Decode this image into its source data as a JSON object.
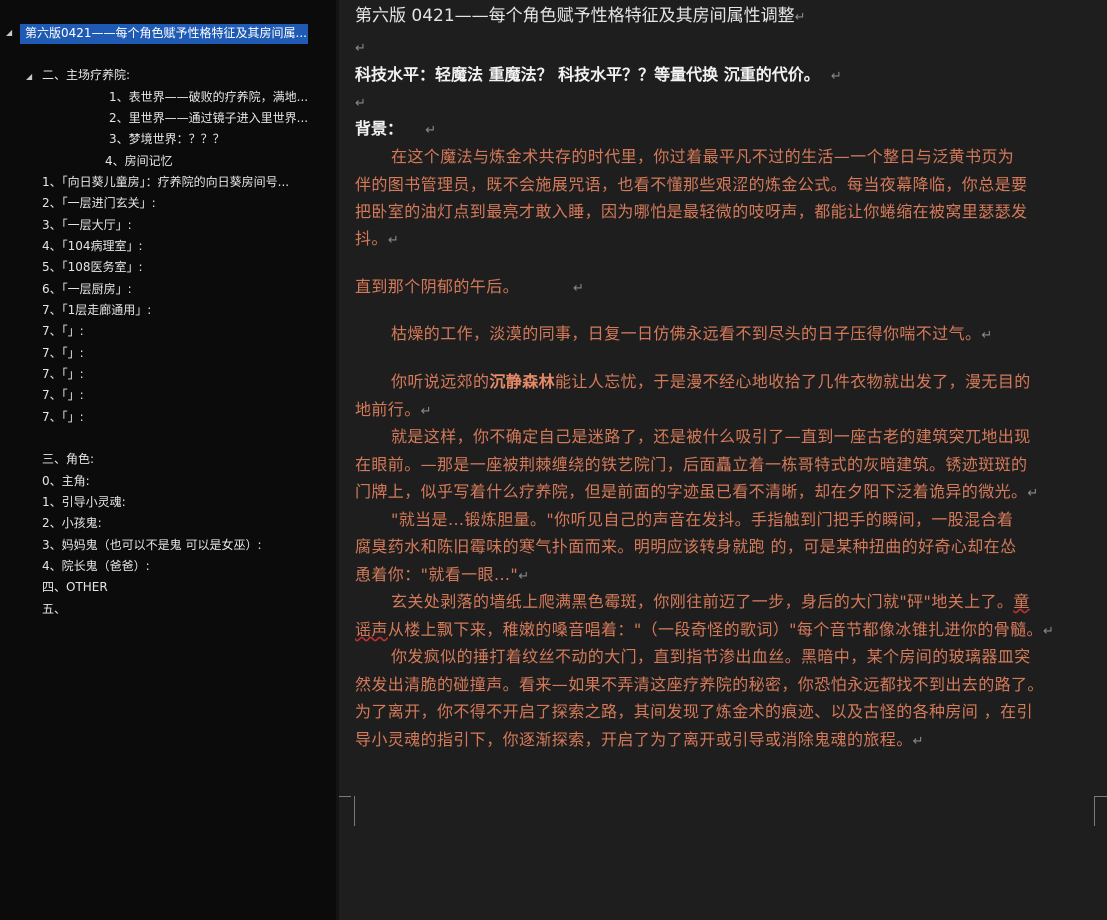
{
  "navigation": {
    "title": "第六版0421——每个角色赋予性格特征及其房间属...",
    "sections": [
      {
        "label": "二、主场疗养院:"
      },
      {
        "label": "1、表世界——破败的疗养院，满地..."
      },
      {
        "label": "2、里世界——通过镜子进入里世界..."
      },
      {
        "label": "3、梦境世界：？？？"
      },
      {
        "label": "4、房间记忆"
      },
      {
        "label": "1、「向日葵儿童房」：疗养院的向日葵房间号..."
      },
      {
        "label": "2、「一层进门玄关」:"
      },
      {
        "label": "3、「一层大厅」:"
      },
      {
        "label": "4、「104病理室」:"
      },
      {
        "label": "5、「108医务室」:"
      },
      {
        "label": "6、「一层厨房」:"
      },
      {
        "label": "7、「1层走廊通用」:"
      },
      {
        "label": "7、「」:"
      },
      {
        "label": "7、「」:"
      },
      {
        "label": "7、「」:"
      },
      {
        "label": "7、「」:"
      },
      {
        "label": "7、「」:"
      },
      {
        "label": "三、角色:"
      },
      {
        "label": "0、主角:"
      },
      {
        "label": "1、引导小灵魂:"
      },
      {
        "label": "2、小孩鬼:"
      },
      {
        "label": "3、妈妈鬼（也可以不是鬼 可以是女巫）:"
      },
      {
        "label": "4、院长鬼（爸爸）:"
      },
      {
        "label": "四、OTHER"
      },
      {
        "label": "五、"
      }
    ]
  },
  "document": {
    "title": "第六版 0421——每个角色赋予性格特征及其房间属性调整",
    "paragraph_mark": "↵",
    "tech_heading": "科技水平：轻魔法  重魔法？  科技水平？？等量代换  沉重的代价。",
    "background_heading": "背景：",
    "p1": [
      "在这个魔法与炼金术共存的时代里，你过着最平凡不过的生活—一个整日与泛黄书页为",
      "伴的图书管理员，既不会施展咒语，也看不懂那些艰涩的炼金公式。每当夜幕降临，你总是要",
      "把卧室的油灯点到最亮才敢入睡，因为哪怕是最轻微的吱呀声，都能让你蜷缩在被窝里瑟瑟发",
      "抖。"
    ],
    "p2": "直到那个阴郁的午后。",
    "p3": "枯燥的工作，淡漠的同事，日复一日仿佛永远看不到尽头的日子压得你喘不过气。",
    "p4_a": "你听说远郊的",
    "p4_bold": "沉静森林",
    "p4_b": "能让人忘忧，于是漫不经心地收拾了几件衣物就出发了，漫无目的",
    "p4_c": "地前行。",
    "p5": [
      "就是这样，你不确定自己是迷路了，还是被什么吸引了—直到一座古老的建筑突兀地出现",
      "在眼前。—那是一座被荆棘缠绕的铁艺院门，后面矗立着一栋哥特式的灰暗建筑。锈迹斑斑的",
      "门牌上，似乎写着什么疗养院，但是前面的字迹虽已看不清晰，却在夕阳下泛着诡异的微光。"
    ],
    "p6": [
      "\"就当是...锻炼胆量。\"你听见自己的声音在发抖。手指触到门把手的瞬间，一股混合着",
      "腐臭药水和陈旧霉味的寒气扑面而来。明明应该转身就跑  的，可是某种扭曲的好奇心却在怂",
      "恿着你：\"就看一眼...\""
    ],
    "p7_a": "玄关处剥落的墙纸上爬满黑色霉斑，你刚往前迈了一步，身后的大门就\"砰\"地关上了。",
    "p7_squig1": "童",
    "p7_squig2": "谣声",
    "p7_b": "从楼上飘下来，稚嫩的嗓音唱着：\"（一段奇怪的歌词）\"每个音节都像冰锥扎进你的骨髓。",
    "p8": [
      "你发疯似的捶打着纹丝不动的大门，直到指节渗出血丝。黑暗中，某个房间的玻璃器皿突",
      "然发出清脆的碰撞声。看来—如果不弄清这座疗养院的秘密，你恐怕永远都找不到出去的路了。",
      "为了离开，你不得不开启了探索之路，其间发现了炼金术的痕迹、以及古怪的各种房间 ，在引",
      "导小灵魂的指引下，你逐渐探索，开启了为了离开或引导或消除鬼魂的旅程。"
    ]
  }
}
